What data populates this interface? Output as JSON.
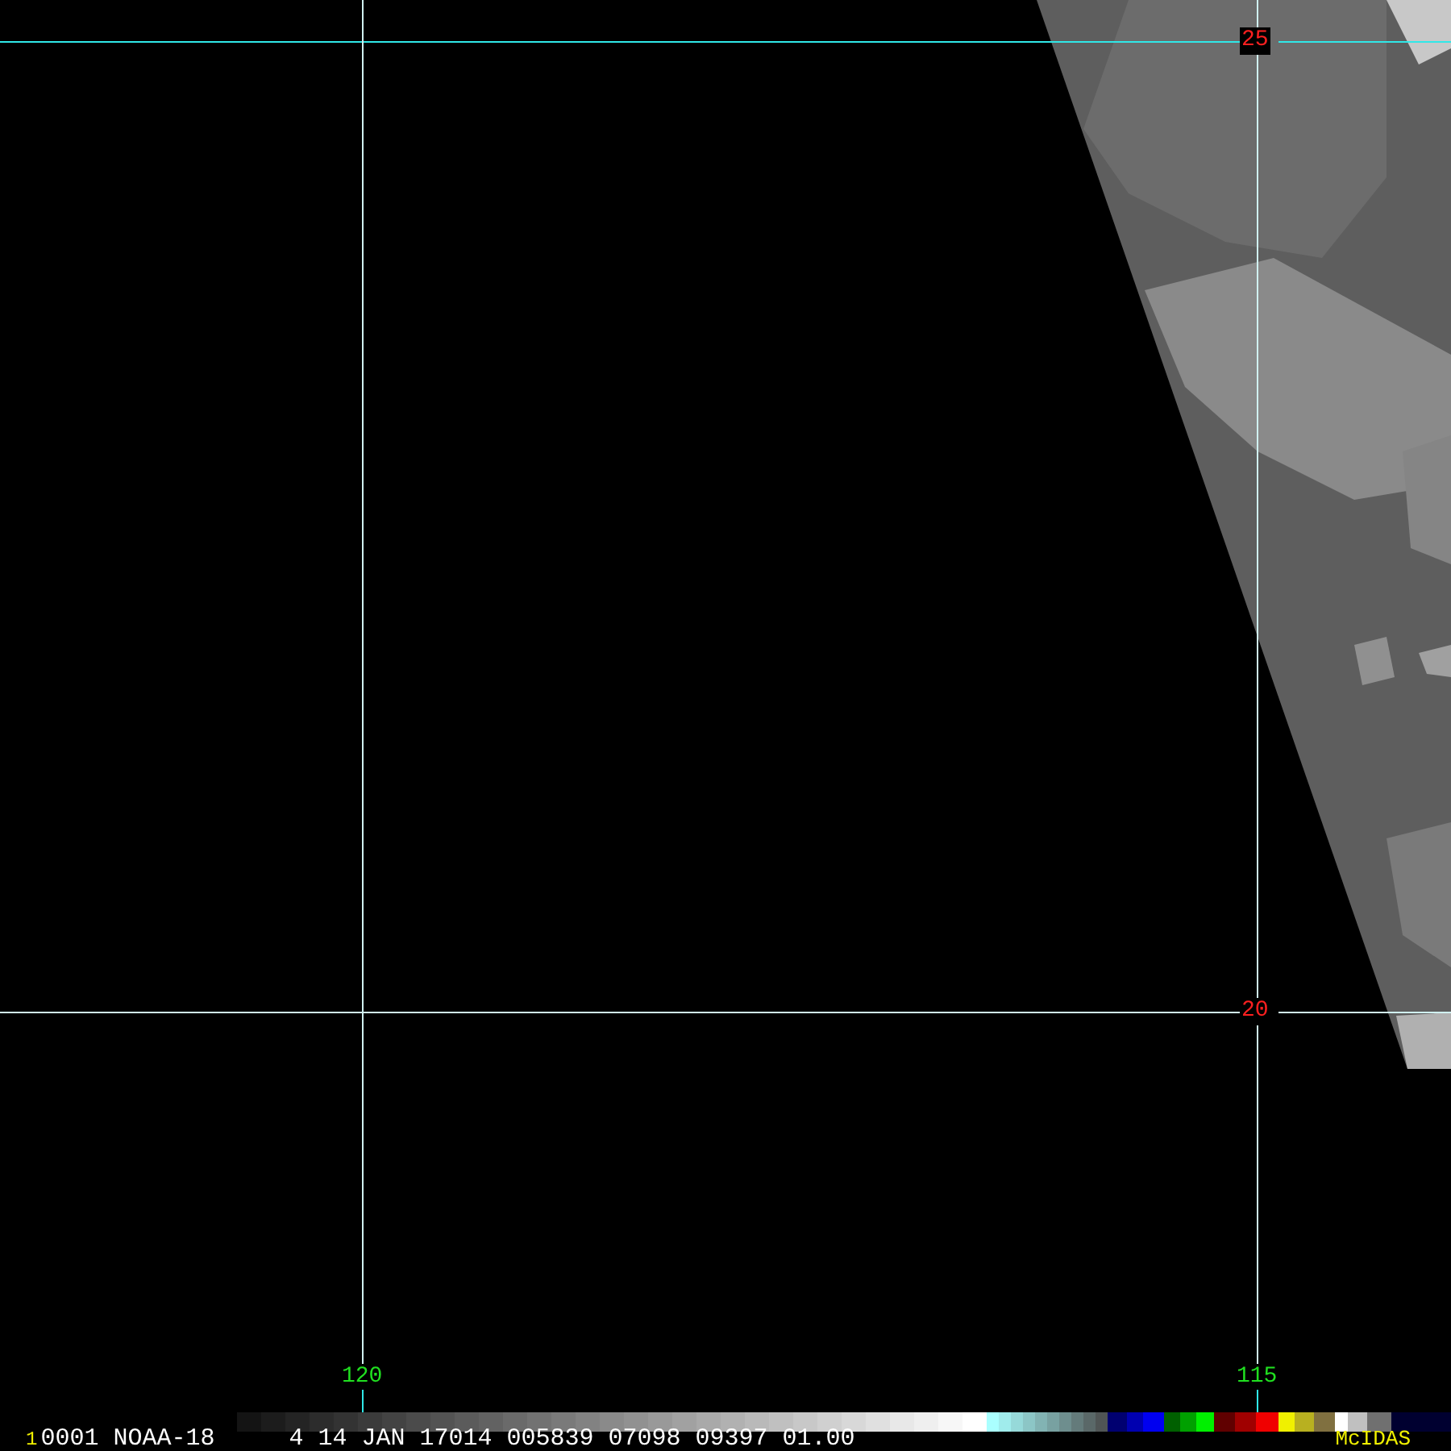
{
  "map": {
    "latitude_labels": [
      "25",
      "20"
    ],
    "longitude_labels": [
      "120",
      "115"
    ]
  },
  "status_bar": {
    "frame": "1",
    "image_id": "0001 NOAA-18",
    "info": "4 14 JAN 17014 005839 07098 09397 01.00",
    "logo": "McIDAS"
  }
}
